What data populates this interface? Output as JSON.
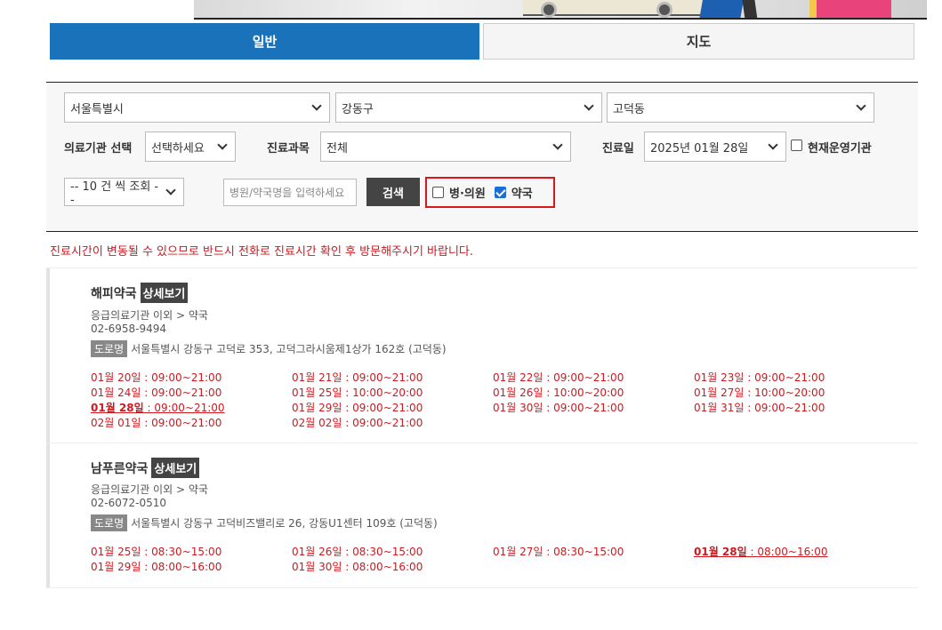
{
  "tabs": [
    {
      "label": "일반",
      "active": true
    },
    {
      "label": "지도",
      "active": false
    }
  ],
  "filters": {
    "city": "서울특별시",
    "district": "강동구",
    "dong": "고덕동",
    "institution_label": "의료기관 선택",
    "institution_value": "선택하세요",
    "subject_label": "진료과목",
    "subject_value": "전체",
    "date_label": "진료일",
    "date_value": "2025년 01월 28일",
    "current_label": "현재운영기관",
    "current_checked": false,
    "page_size": "-- 10 건 씩 조회 --",
    "search_placeholder": "병원/약국명을 입력하세요",
    "search_button": "검색",
    "type_hospital": "병·의원",
    "type_hospital_checked": false,
    "type_pharmacy": "약국",
    "type_pharmacy_checked": true
  },
  "notice": "진료시간이 변동될 수 있으므로 반드시 전화로 진료시간 확인 후 방문해주시기 바랍니다.",
  "results": [
    {
      "name": "해피약국",
      "detail": "상세보기",
      "category": "응급의료기관 이외 > 약국",
      "phone": "02-6958-9494",
      "road_label": "도로명",
      "address": "서울특별시 강동구 고덕로 353, 고덕그라시움제1상가 162호 (고덕동)",
      "hours": [
        {
          "d": "01월 20일",
          "t": " : 09:00~21:00",
          "style": "gray"
        },
        {
          "d": "01월 21일",
          "t": " : 09:00~21:00",
          "style": "gray"
        },
        {
          "d": "01월 22일",
          "t": " : 09:00~21:00",
          "style": "gray"
        },
        {
          "d": "01월 23일",
          "t": " : 09:00~21:00",
          "style": "gray"
        },
        {
          "d": "01월 24일",
          "t": " : 09:00~21:00",
          "style": "gray"
        },
        {
          "d": "01월 25일",
          "t": " : 10:00~20:00",
          "style": "red"
        },
        {
          "d": "01월 26일",
          "t": " : 10:00~20:00",
          "style": "red"
        },
        {
          "d": "01월 27일",
          "t": " : 10:00~20:00",
          "style": "red"
        },
        {
          "d": "01월 28일",
          "t": " : 09:00~21:00",
          "style": "today"
        },
        {
          "d": "01월 29일",
          "t": " : 09:00~21:00",
          "style": "red"
        },
        {
          "d": "01월 30일",
          "t": " : 09:00~21:00",
          "style": "red"
        },
        {
          "d": "01월 31일",
          "t": " : 09:00~21:00",
          "style": "red"
        },
        {
          "d": "02월 01일",
          "t": " : 09:00~21:00",
          "style": "red"
        },
        {
          "d": "02월 02일",
          "t": " : 09:00~21:00",
          "style": "red"
        }
      ]
    },
    {
      "name": "남푸른약국",
      "detail": "상세보기",
      "category": "응급의료기관 이외 > 약국",
      "phone": "02-6072-0510",
      "road_label": "도로명",
      "address": "서울특별시 강동구 고덕비즈밸리로 26, 강동U1센터 109호 (고덕동)",
      "hours": [
        {
          "d": "01월 25일",
          "t": " : 08:30~15:00",
          "style": "red"
        },
        {
          "d": "01월 26일",
          "t": " : 08:30~15:00",
          "style": "red"
        },
        {
          "d": "01월 27일",
          "t": " : 08:30~15:00",
          "style": "red"
        },
        {
          "d": "01월 28일",
          "t": " : 08:00~16:00",
          "style": "today"
        },
        {
          "d": "01월 29일",
          "t": " : 08:00~16:00",
          "style": "red"
        },
        {
          "d": "01월 30일",
          "t": " : 08:00~16:00",
          "style": "red"
        }
      ]
    }
  ]
}
